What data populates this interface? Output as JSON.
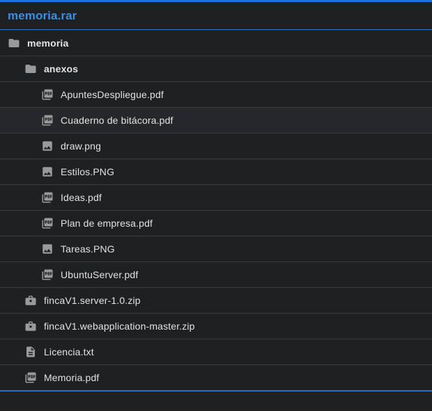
{
  "archive": {
    "title": "memoria.rar"
  },
  "colors": {
    "accent": "#1a73d6",
    "title": "#3a8ee6",
    "background": "#1f2022",
    "divider": "#3a3b3e",
    "icon": "#9a9a9a"
  },
  "tree": {
    "root": {
      "label": "memoria",
      "icon": "folder-icon"
    },
    "anexos": {
      "label": "anexos",
      "icon": "folder-icon"
    },
    "anexos_files": [
      {
        "label": "ApuntesDespliegue.pdf",
        "icon": "pdf-icon"
      },
      {
        "label": "Cuaderno de bitácora.pdf",
        "icon": "pdf-icon",
        "hovered": true
      },
      {
        "label": "draw.png",
        "icon": "image-icon"
      },
      {
        "label": "Estilos.PNG",
        "icon": "image-icon"
      },
      {
        "label": "Ideas.pdf",
        "icon": "pdf-icon"
      },
      {
        "label": "Plan de empresa.pdf",
        "icon": "pdf-icon"
      },
      {
        "label": "Tareas.PNG",
        "icon": "image-icon"
      },
      {
        "label": "UbuntuServer.pdf",
        "icon": "pdf-icon"
      }
    ],
    "root_files": [
      {
        "label": "fincaV1.server-1.0.zip",
        "icon": "archive-icon"
      },
      {
        "label": "fincaV1.webapplication-master.zip",
        "icon": "archive-icon"
      },
      {
        "label": "Licencia.txt",
        "icon": "text-file-icon"
      },
      {
        "label": "Memoria.pdf",
        "icon": "pdf-icon"
      }
    ]
  }
}
